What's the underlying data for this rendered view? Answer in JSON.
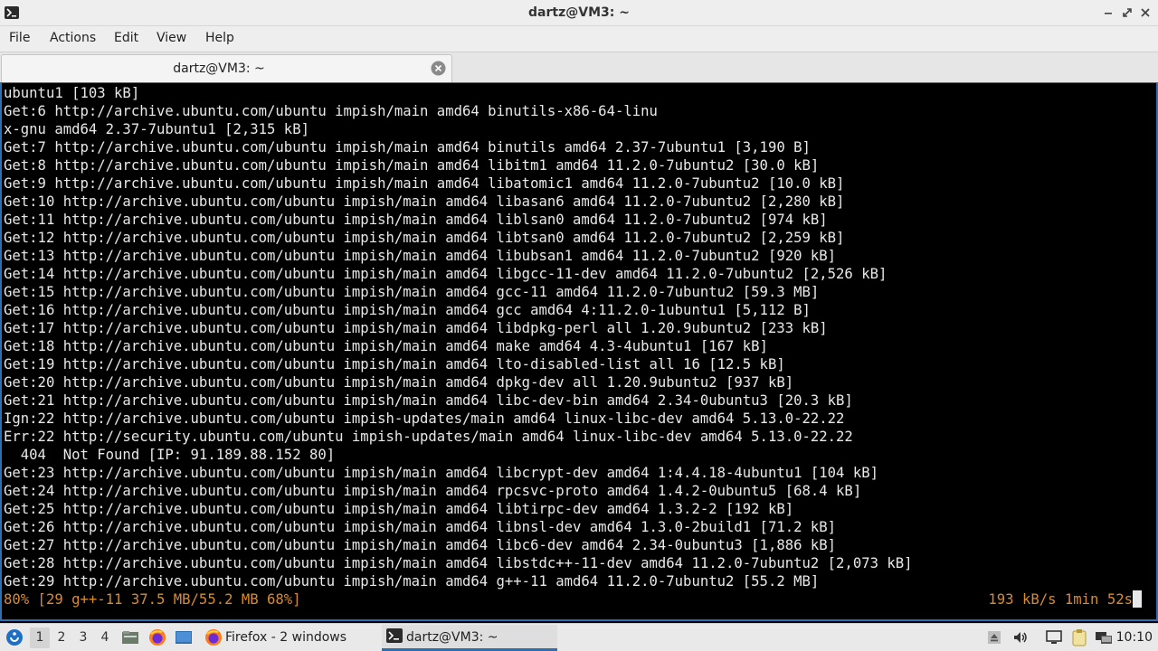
{
  "window": {
    "title": "dartz@VM3: ~",
    "app_icon": "terminal-icon",
    "controls": [
      "minimize-icon",
      "restore-icon",
      "close-icon"
    ]
  },
  "menubar": {
    "items": [
      {
        "label": "File"
      },
      {
        "label": "Actions"
      },
      {
        "label": "Edit"
      },
      {
        "label": "View"
      },
      {
        "label": "Help"
      }
    ]
  },
  "tabs": [
    {
      "label": "dartz@VM3: ~",
      "close_icon": "close-circle-icon"
    }
  ],
  "terminal": {
    "lines": [
      "ubuntu1 [103 kB]",
      "Get:6 http://archive.ubuntu.com/ubuntu impish/main amd64 binutils-x86-64-linu",
      "x-gnu amd64 2.37-7ubuntu1 [2,315 kB]",
      "Get:7 http://archive.ubuntu.com/ubuntu impish/main amd64 binutils amd64 2.37-7ubuntu1 [3,190 B]",
      "Get:8 http://archive.ubuntu.com/ubuntu impish/main amd64 libitm1 amd64 11.2.0-7ubuntu2 [30.0 kB]",
      "Get:9 http://archive.ubuntu.com/ubuntu impish/main amd64 libatomic1 amd64 11.2.0-7ubuntu2 [10.0 kB]",
      "Get:10 http://archive.ubuntu.com/ubuntu impish/main amd64 libasan6 amd64 11.2.0-7ubuntu2 [2,280 kB]",
      "Get:11 http://archive.ubuntu.com/ubuntu impish/main amd64 liblsan0 amd64 11.2.0-7ubuntu2 [974 kB]",
      "Get:12 http://archive.ubuntu.com/ubuntu impish/main amd64 libtsan0 amd64 11.2.0-7ubuntu2 [2,259 kB]",
      "Get:13 http://archive.ubuntu.com/ubuntu impish/main amd64 libubsan1 amd64 11.2.0-7ubuntu2 [920 kB]",
      "Get:14 http://archive.ubuntu.com/ubuntu impish/main amd64 libgcc-11-dev amd64 11.2.0-7ubuntu2 [2,526 kB]",
      "Get:15 http://archive.ubuntu.com/ubuntu impish/main amd64 gcc-11 amd64 11.2.0-7ubuntu2 [59.3 MB]",
      "Get:16 http://archive.ubuntu.com/ubuntu impish/main amd64 gcc amd64 4:11.2.0-1ubuntu1 [5,112 B]",
      "Get:17 http://archive.ubuntu.com/ubuntu impish/main amd64 libdpkg-perl all 1.20.9ubuntu2 [233 kB]",
      "Get:18 http://archive.ubuntu.com/ubuntu impish/main amd64 make amd64 4.3-4ubuntu1 [167 kB]",
      "Get:19 http://archive.ubuntu.com/ubuntu impish/main amd64 lto-disabled-list all 16 [12.5 kB]",
      "Get:20 http://archive.ubuntu.com/ubuntu impish/main amd64 dpkg-dev all 1.20.9ubuntu2 [937 kB]",
      "Get:21 http://archive.ubuntu.com/ubuntu impish/main amd64 libc-dev-bin amd64 2.34-0ubuntu3 [20.3 kB]",
      "Ign:22 http://archive.ubuntu.com/ubuntu impish-updates/main amd64 linux-libc-dev amd64 5.13.0-22.22",
      "Err:22 http://security.ubuntu.com/ubuntu impish-updates/main amd64 linux-libc-dev amd64 5.13.0-22.22",
      "  404  Not Found [IP: 91.189.88.152 80]",
      "Get:23 http://archive.ubuntu.com/ubuntu impish/main amd64 libcrypt-dev amd64 1:4.4.18-4ubuntu1 [104 kB]",
      "Get:24 http://archive.ubuntu.com/ubuntu impish/main amd64 rpcsvc-proto amd64 1.4.2-0ubuntu5 [68.4 kB]",
      "Get:25 http://archive.ubuntu.com/ubuntu impish/main amd64 libtirpc-dev amd64 1.3.2-2 [192 kB]",
      "Get:26 http://archive.ubuntu.com/ubuntu impish/main amd64 libnsl-dev amd64 1.3.0-2build1 [71.2 kB]",
      "Get:27 http://archive.ubuntu.com/ubuntu impish/main amd64 libc6-dev amd64 2.34-0ubuntu3 [1,886 kB]",
      "Get:28 http://archive.ubuntu.com/ubuntu impish/main amd64 libstdc++-11-dev amd64 11.2.0-7ubuntu2 [2,073 kB]",
      "Get:29 http://archive.ubuntu.com/ubuntu impish/main amd64 g++-11 amd64 11.2.0-7ubuntu2 [55.2 MB]"
    ],
    "status_left": "80% [29 g++-11 37.5 MB/55.2 MB 68%]",
    "status_right": "193 kB/s 1min 52s",
    "status_color": "#d98a2e",
    "border_color": "#2f6fb0"
  },
  "taskbar": {
    "start_icon": "start-menu-icon",
    "workspaces": [
      "1",
      "2",
      "3",
      "4"
    ],
    "active_workspace": "1",
    "launchers": [
      "file-manager-icon",
      "firefox-icon",
      "show-desktop-icon"
    ],
    "tasks": [
      {
        "label": "Firefox - 2 windows",
        "icon": "firefox-icon"
      },
      {
        "label": "dartz@VM3: ~",
        "icon": "terminal-icon"
      }
    ],
    "tray": [
      "eject-icon",
      "volume-icon",
      "monitor-icon",
      "clipboard-icon",
      "network-icon"
    ],
    "clock": "10:10"
  }
}
